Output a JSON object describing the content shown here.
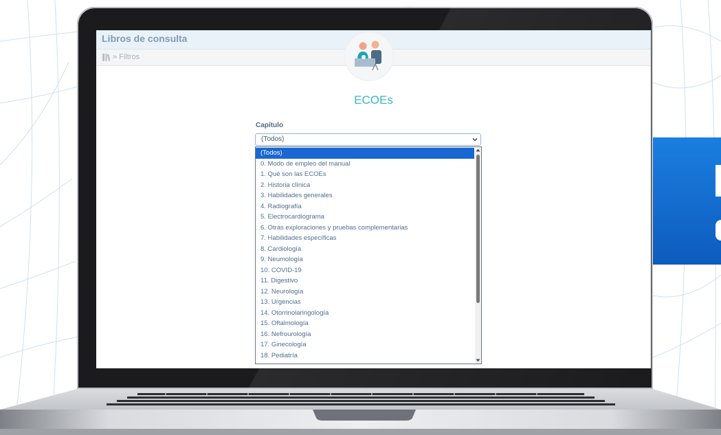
{
  "app": {
    "title": "Libros de consulta"
  },
  "breadcrumb": {
    "text": "» Filtros"
  },
  "page": {
    "title": "ECOEs"
  },
  "filter": {
    "label": "Capítulo",
    "selected": "(Todos)",
    "options": [
      "(Todos)",
      "0. Modo de empleo del manual",
      "1. Qué son las ECOEs",
      "2. Historia clínica",
      "3. Habilidades generales",
      "4. Radiografía",
      "5. Electrocardiograma",
      "6. Otras exploraciones y pruebas complementarias",
      "7. Habilidades específicas",
      "8. Cardiología",
      "9. Neumología",
      "10. COVID-19",
      "11. Digestivo",
      "12. Neurología",
      "13. Urgencias",
      "14. Otorrinolaringología",
      "15. Oftalmología",
      "16. Nefrourología",
      "17. Ginecología",
      "18. Pediatría"
    ]
  },
  "colors": {
    "accent": "#3ab5c9",
    "selection": "#1967d2",
    "promo": "#0d5bbd"
  }
}
